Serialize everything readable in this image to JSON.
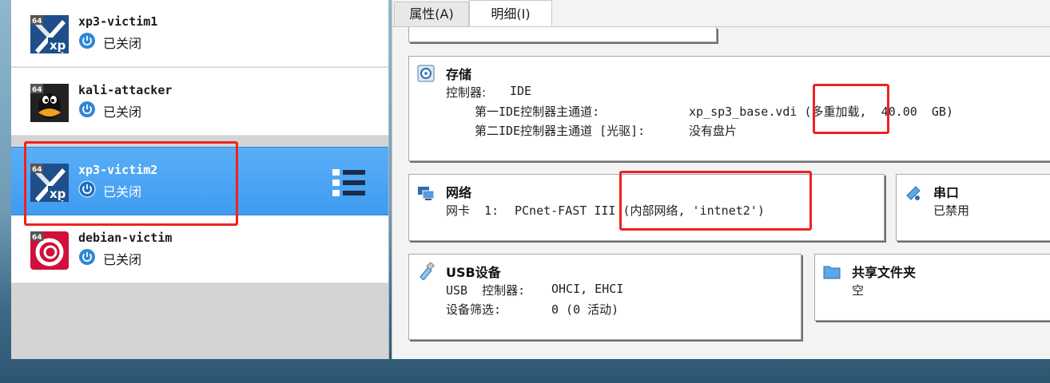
{
  "vm_list": [
    {
      "name": "xp3-victim1",
      "state": "已关闭",
      "os": "xp",
      "badge": "64",
      "selected": false
    },
    {
      "name": "kali-attacker",
      "state": "已关闭",
      "os": "linux",
      "badge": "64",
      "selected": false
    },
    {
      "name": "xp3-victim2",
      "state": "已关闭",
      "os": "xp",
      "badge": "64",
      "selected": true
    },
    {
      "name": "debian-victim",
      "state": "已关闭",
      "os": "debian",
      "badge": "64",
      "selected": false
    }
  ],
  "icon_badge": "64",
  "xp_label": "xp",
  "tabs": [
    {
      "label": "属性(A)",
      "active": false
    },
    {
      "label": "明细(I)",
      "active": true
    }
  ],
  "storage": {
    "title": "存储",
    "controller_label": "控制器:",
    "controller_value": "IDE",
    "primary_label": "第一IDE控制器主通道:",
    "primary_value": "xp_sp3_base.vdi (多重加载,  40.00  GB)",
    "secondary_label": "第二IDE控制器主通道 [光驱]:",
    "secondary_value": "没有盘片"
  },
  "network": {
    "title": "网络",
    "adapter_label": "网卡  1:",
    "adapter_value": "PCnet-FAST III (内部网络, 'intnet2')"
  },
  "serial": {
    "title": "串口",
    "value": "已禁用"
  },
  "usb": {
    "title": "USB设备",
    "controller_label": "USB  控制器:",
    "controller_value": "OHCI, EHCI",
    "filter_label": "设备筛选:",
    "filter_value": "0 (0 活动)"
  },
  "shared": {
    "title": "共享文件夹",
    "value": "空"
  },
  "colors": {
    "selection": "#3f9cf1",
    "highlight": "#ee2222"
  }
}
